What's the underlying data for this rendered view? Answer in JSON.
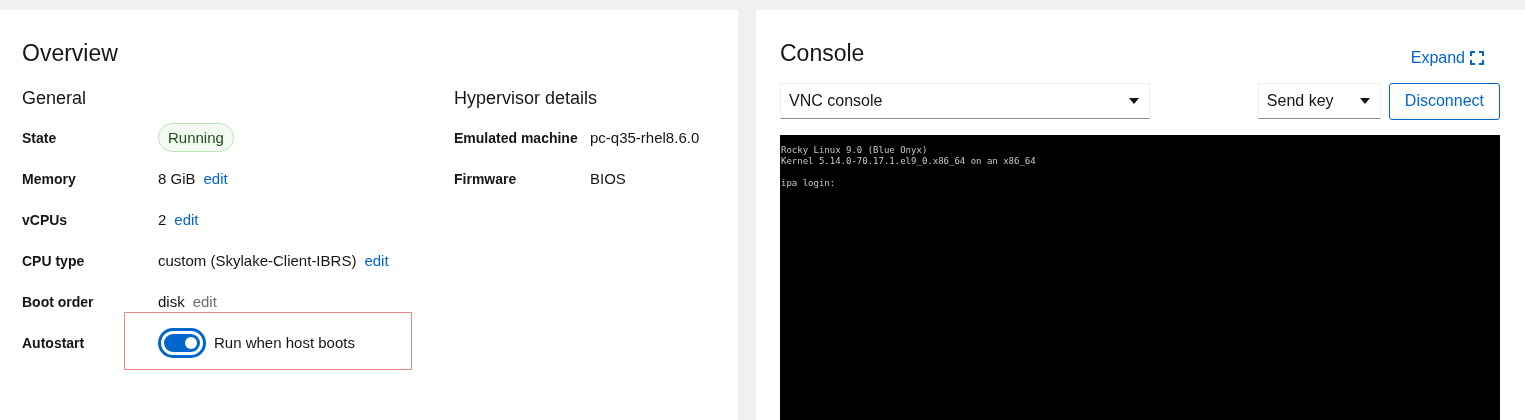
{
  "overview": {
    "title": "Overview",
    "general": {
      "title": "General",
      "rows": [
        {
          "kind": "badge",
          "label": "State",
          "value": "Running"
        },
        {
          "kind": "text",
          "label": "Memory",
          "value": "8 GiB",
          "edit": {
            "label": "edit",
            "disabled": false
          }
        },
        {
          "kind": "text",
          "label": "vCPUs",
          "value": "2",
          "edit": {
            "label": "edit",
            "disabled": false
          }
        },
        {
          "kind": "text",
          "label": "CPU type",
          "value": "custom (Skylake-Client-IBRS)",
          "edit": {
            "label": "edit",
            "disabled": false
          }
        },
        {
          "kind": "text",
          "label": "Boot order",
          "value": "disk",
          "edit": {
            "label": "edit",
            "disabled": true
          }
        },
        {
          "kind": "switch",
          "label": "Autostart",
          "on": true,
          "value": "Run when host boots",
          "highlighted": true
        }
      ]
    },
    "hypervisor": {
      "title": "Hypervisor details",
      "rows": [
        {
          "label": "Emulated machine",
          "value": "pc-q35-rhel8.6.0"
        },
        {
          "label": "Firmware",
          "value": "BIOS"
        }
      ]
    }
  },
  "console": {
    "title": "Console",
    "expand": "Expand",
    "type_select": "VNC console",
    "send_key": "Send key",
    "disconnect": "Disconnect",
    "screen_banner": [
      "Rocky Linux 9.0 (Blue Onyx)",
      "Kernel 5.14.0-70.17.1.el9_0.x86_64 on an x86_64"
    ],
    "screen_prompt": "ipa login:"
  }
}
